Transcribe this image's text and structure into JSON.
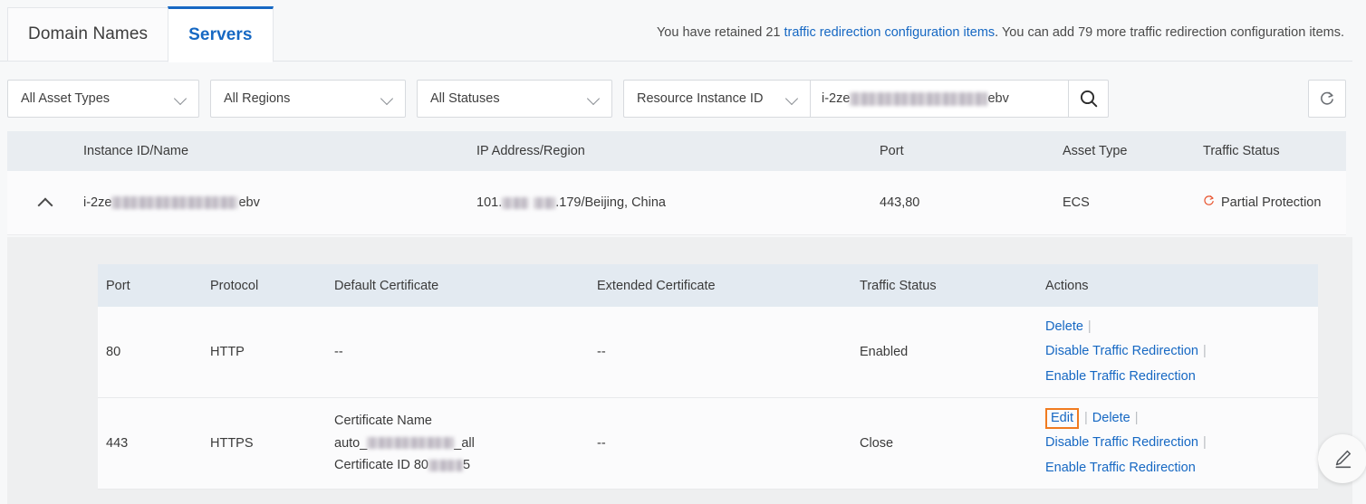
{
  "tabs": [
    {
      "label": "Domain Names",
      "active": false
    },
    {
      "label": "Servers",
      "active": true
    }
  ],
  "notice": {
    "prefix": "You have retained 21 ",
    "link": "traffic redirection configuration items",
    "suffix": ". You can add 79 more traffic redirection configuration items."
  },
  "filters": {
    "asset_type": "All Asset Types",
    "region": "All Regions",
    "status": "All Statuses",
    "search_field": "Resource Instance ID",
    "search_value_prefix": "i-2ze",
    "search_value_suffix": "ebv",
    "search_icon": "search-icon",
    "refresh_icon": "refresh-icon"
  },
  "outer_table": {
    "columns": [
      "Instance ID/Name",
      "IP Address/Region",
      "Port",
      "Asset Type",
      "Traffic Status"
    ],
    "row": {
      "expand_icon": "chevron-up-icon",
      "instance_prefix": "i-2ze",
      "instance_suffix": "ebv",
      "ip_prefix": "101.",
      "ip_suffix": ".179/Beijing, China",
      "port": "443,80",
      "asset_type": "ECS",
      "traffic_status": "Partial Protection",
      "traffic_status_icon": "refresh-warning-icon",
      "traffic_status_color": "#e8542f"
    }
  },
  "inner_table": {
    "columns": [
      "Port",
      "Protocol",
      "Default Certificate",
      "Extended Certificate",
      "Traffic Status",
      "Actions"
    ],
    "rows": [
      {
        "port": "80",
        "protocol": "HTTP",
        "default_certificate": "--",
        "extended_certificate": "--",
        "traffic_status": "Enabled",
        "actions": [
          "Delete",
          "Disable Traffic Redirection",
          "Enable Traffic Redirection"
        ],
        "has_edit": false
      },
      {
        "port": "443",
        "protocol": "HTTPS",
        "cert_name_label": "Certificate Name",
        "cert_name_prefix": "auto_",
        "cert_name_suffix": "_all",
        "cert_id_label": "Certificate ID 80",
        "cert_id_suffix": "5",
        "extended_certificate": "--",
        "traffic_status": "Close",
        "edit_label": "Edit",
        "actions": [
          "Delete",
          "Disable Traffic Redirection",
          "Enable Traffic Redirection"
        ],
        "has_edit": true,
        "highlight_color": "#f07b20"
      }
    ]
  },
  "fab": {
    "icon": "pencil-edit-icon"
  },
  "colors": {
    "link": "#1668c3",
    "accent": "#1668c3",
    "highlight": "#f07b20",
    "warning": "#e8542f"
  }
}
